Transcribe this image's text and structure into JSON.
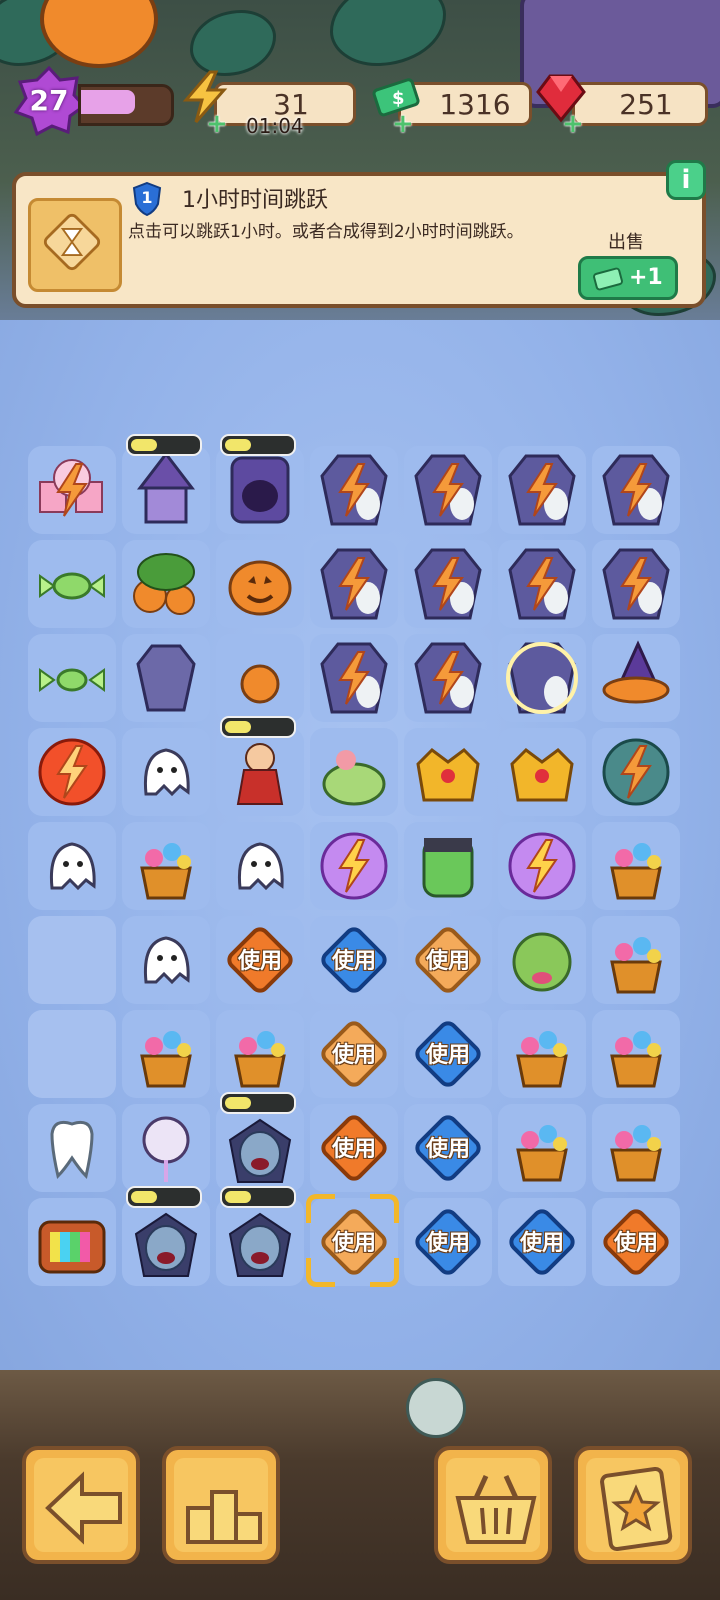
{
  "player": {
    "level": "27",
    "xp_progress": 0.6
  },
  "resources": {
    "energy": {
      "value": "31",
      "timer": "01:04",
      "icon": "lightning-icon"
    },
    "cash": {
      "value": "1316",
      "icon": "cash-stack-icon"
    },
    "gems": {
      "value": "251",
      "icon": "ruby-icon"
    }
  },
  "info_panel": {
    "level": "1",
    "title": "1小时时间跳跃",
    "description": "点击可以跳跃1小时。或者合成得到2小时时间跳跃。",
    "sell_label": "出售",
    "sell_value": "+1",
    "info_button": "i"
  },
  "board": {
    "use_label": "使用",
    "rows": [
      [
        "cupcake-generator",
        "witch-house",
        "haunted-wardrobe",
        "locked-coffin",
        "locked-coffin",
        "locked-coffin",
        "locked-coffin"
      ],
      [
        "candy",
        "pumpkin-patch",
        "jack-o-lantern",
        "locked-coffin",
        "locked-coffin",
        "locked-coffin",
        "locked-coffin"
      ],
      [
        "small-candy",
        "spider-coffin",
        "small-pumpkin",
        "locked-coffin",
        "locked-coffin",
        "glowing-coffin",
        "witch-hat"
      ],
      [
        "energy-orb-red",
        "ghost",
        "red-riding-hood",
        "candy-basket",
        "golden-crown",
        "golden-crown",
        "haunted-tree"
      ],
      [
        "ghost",
        "flower-basket",
        "ghost",
        "energy-orb-purple",
        "frankenstein",
        "energy-orb-purple",
        "flower-basket"
      ],
      [
        "empty",
        "ghost",
        "use-orange",
        "use-blue",
        "use-orange-light",
        "zombie-head",
        "flower-basket"
      ],
      [
        "empty",
        "flower-basket",
        "flower-basket",
        "use-orange-light",
        "use-blue",
        "flower-basket",
        "flower-basket"
      ],
      [
        "tooth",
        "ghost-lollipop",
        "vampire",
        "use-orange",
        "use-blue",
        "flower-basket",
        "flower-basket"
      ],
      [
        "retro-tv",
        "vampire",
        "vampire",
        "use-orange-light",
        "use-blue",
        "use-blue",
        "use-orange"
      ]
    ],
    "busy_cells": [
      "0-1",
      "0-2",
      "3-2",
      "7-2",
      "8-1",
      "8-2"
    ],
    "selected_cell": "8-3"
  },
  "bottom_bar": {
    "buttons": [
      {
        "name": "back-button",
        "icon": "back-arrow-icon"
      },
      {
        "name": "leaderboard-button",
        "icon": "podium-icon"
      },
      {
        "name": "shop-button",
        "icon": "basket-icon"
      },
      {
        "name": "tasks-button",
        "icon": "clipboard-star-icon"
      }
    ]
  },
  "colors": {
    "accent_green": "#3fbf76",
    "panel": "#f8e6c6",
    "board": "#93b2e9",
    "border_brown": "#7a4f2b"
  }
}
